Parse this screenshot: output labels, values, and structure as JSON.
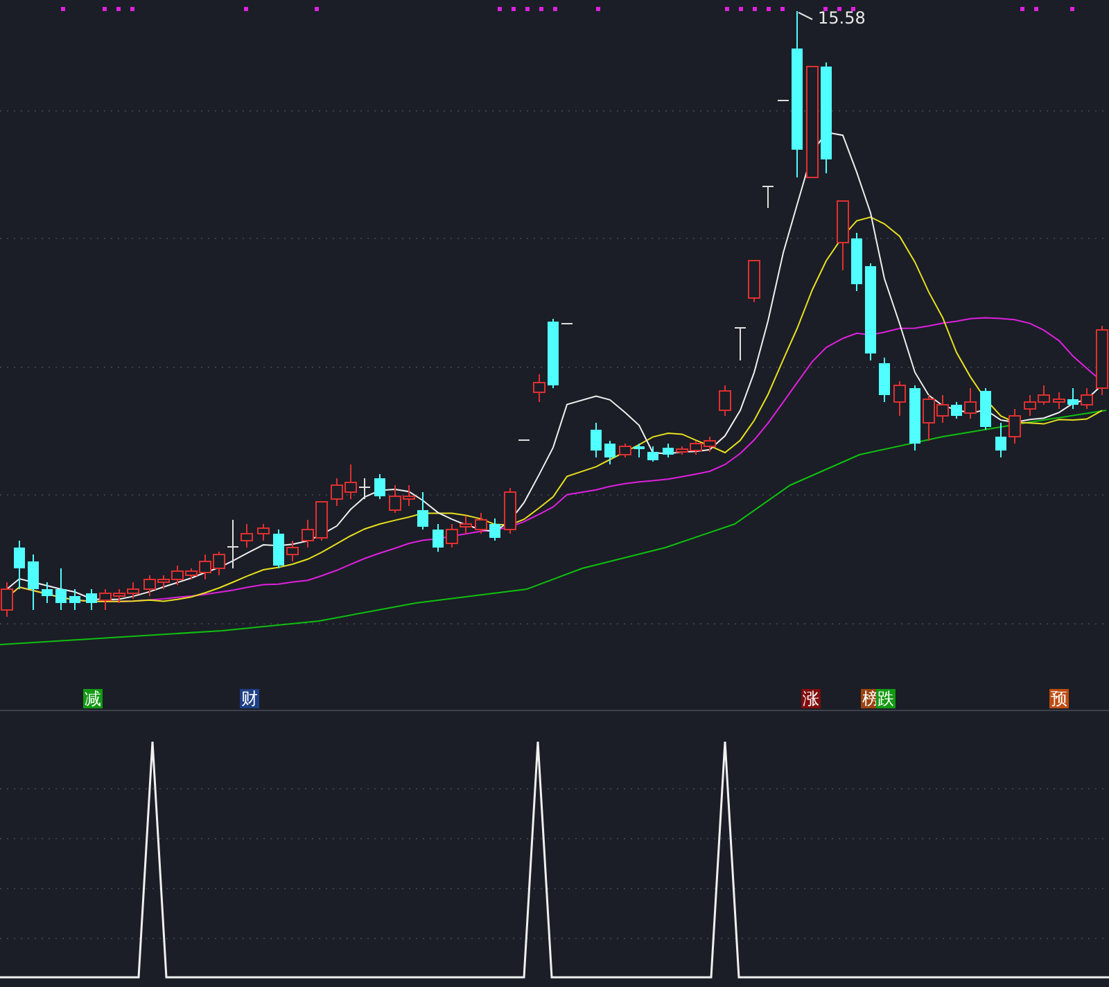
{
  "price_chart": {
    "high_label": "15.58",
    "event_tags": [
      {
        "label": "减",
        "color": "#129a12"
      },
      {
        "label": "财",
        "color": "#1d3f86"
      },
      {
        "label": "涨",
        "color": "#7f0d0d"
      },
      {
        "label": "榜",
        "color": "#9a4410"
      },
      {
        "label": "跌",
        "color": "#129a12"
      },
      {
        "label": "预",
        "color": "#bf4c12"
      }
    ]
  }
}
